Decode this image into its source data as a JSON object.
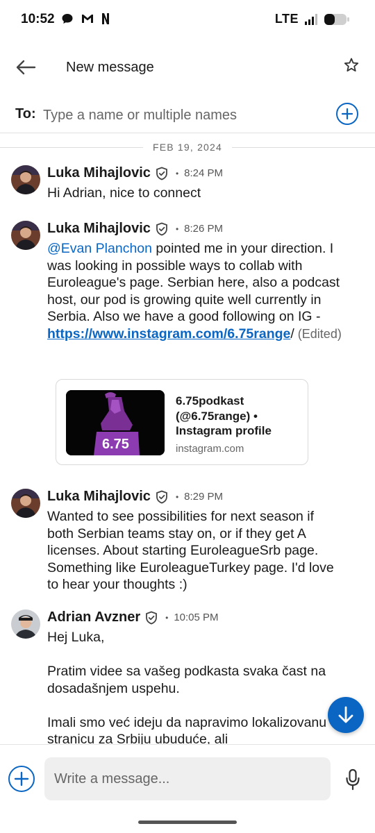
{
  "status_bar": {
    "time": "10:52",
    "network": "LTE",
    "left_icons": [
      "chat-bubble-icon",
      "gmail-icon",
      "netflix-icon"
    ],
    "right_icons": [
      "signal-icon",
      "battery-icon"
    ]
  },
  "header": {
    "title": "New message",
    "back_icon": "arrow-left-icon",
    "star_icon": "star-outline-icon"
  },
  "to_row": {
    "label": "To:",
    "placeholder": "Type a name or multiple names",
    "add_icon": "plus-circle-icon"
  },
  "date_divider": "FEB 19, 2024",
  "messages": [
    {
      "sender": "Luka Mihajlovic",
      "verified": true,
      "time": "8:24 PM",
      "text": "Hi Adrian, nice to connect"
    },
    {
      "sender": "Luka Mihajlovic",
      "verified": true,
      "time": "8:26 PM",
      "mention": "@Evan Planchon",
      "text_before_link": " pointed me in your direction. I was looking in possible ways to collab with Euroleague's page. Serbian here, also a podcast host, our pod is growing quite well currently in Serbia. Also we have a good following on IG - ",
      "link_text": "https://www.instagram.com/6.75range",
      "after_link": "/",
      "edited": " (Edited)",
      "preview": {
        "title": "6.75podkast (@6.75range) • Instagram profile",
        "domain": "instagram.com",
        "image_text": "6.75"
      }
    },
    {
      "sender": "Luka Mihajlovic",
      "verified": true,
      "time": "8:29 PM",
      "text": "Wanted to see possibilities for next season if both Serbian teams stay on, or if they get A licenses. About starting EuroleagueSrb page. Something like EuroleagueTurkey page. I'd love to hear your thoughts :)"
    },
    {
      "sender": "Adrian Avzner",
      "verified": true,
      "time": "10:05 PM",
      "line1": "Hej Luka,",
      "line2": "Pratim videe sa vašeg podkasta svaka čast na dosadašnjem uspehu.",
      "line3": "Imali smo već ideju da napravimo lokalizovanu stranicu za Srbiju ubuduće, ali"
    }
  ],
  "composer": {
    "placeholder": "Write a message...",
    "add_icon": "plus-circle-icon",
    "mic_icon": "microphone-icon"
  },
  "colors": {
    "accent": "#0a66c2",
    "text": "#1a1a1a",
    "muted": "#666666"
  }
}
